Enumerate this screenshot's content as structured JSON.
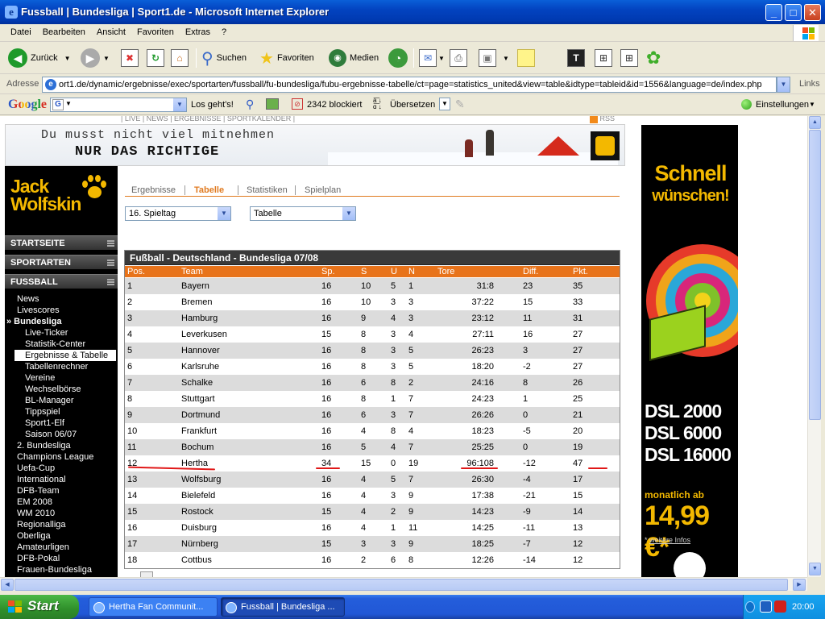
{
  "window": {
    "title": "Fussball | Bundesliga | Sport1.de - Microsoft Internet Explorer",
    "minimize": "_",
    "maximize": "□",
    "close": "✕"
  },
  "menu": [
    "Datei",
    "Bearbeiten",
    "Ansicht",
    "Favoriten",
    "Extras",
    "?"
  ],
  "toolbar": {
    "back": "Zurück",
    "search": "Suchen",
    "favorites": "Favoriten",
    "media": "Medien"
  },
  "address": {
    "label": "Adresse",
    "url": "ort1.de/dynamic/ergebnisse/exec/sportarten/fussball/fu-bundesliga/fubu-ergebnisse-tabelle/ct=page=statistics_united&view=table&idtype=tableid&id=1556&language=de/index.php",
    "links": "Links"
  },
  "googlebar": {
    "logo": "Google",
    "go": "Los geht's!",
    "blocked": "2342 blockiert",
    "translate": "Übersetzen",
    "settings": "Einstellungen"
  },
  "page": {
    "topnav": "|  LIVE  |  NEWS  |  ERGEBNISSE  |  SPORTKALENDER  |",
    "rss": "RSS",
    "banner": {
      "line1": "Du musst nicht viel mitnehmen",
      "line2": "NUR DAS RICHTIGE"
    },
    "logo": {
      "line1": "Jack",
      "line2": "Wolfskin"
    },
    "nav_heads": [
      "STARTSEITE",
      "SPORTARTEN",
      "FUSSBALL"
    ],
    "nav_items": [
      {
        "label": "News",
        "indent": 15,
        "style": ""
      },
      {
        "label": "Livescores",
        "indent": 15,
        "style": ""
      },
      {
        "label": "» Bundesliga",
        "indent": 2,
        "style": "bold"
      },
      {
        "label": "Live-Ticker",
        "indent": 25,
        "style": ""
      },
      {
        "label": "Statistik-Center",
        "indent": 25,
        "style": ""
      },
      {
        "label": "Ergebnisse & Tabelle",
        "indent": 25,
        "style": "sel"
      },
      {
        "label": "Tabellenrechner",
        "indent": 25,
        "style": ""
      },
      {
        "label": "Vereine",
        "indent": 25,
        "style": ""
      },
      {
        "label": "Wechselbörse",
        "indent": 25,
        "style": ""
      },
      {
        "label": "BL-Manager",
        "indent": 25,
        "style": ""
      },
      {
        "label": "Tippspiel",
        "indent": 25,
        "style": ""
      },
      {
        "label": "Sport1-Elf",
        "indent": 25,
        "style": ""
      },
      {
        "label": "Saison 06/07",
        "indent": 25,
        "style": ""
      },
      {
        "label": "2. Bundesliga",
        "indent": 15,
        "style": ""
      },
      {
        "label": "Champions League",
        "indent": 15,
        "style": ""
      },
      {
        "label": "Uefa-Cup",
        "indent": 15,
        "style": ""
      },
      {
        "label": "International",
        "indent": 15,
        "style": ""
      },
      {
        "label": "DFB-Team",
        "indent": 15,
        "style": ""
      },
      {
        "label": "EM 2008",
        "indent": 15,
        "style": ""
      },
      {
        "label": "WM 2010",
        "indent": 15,
        "style": ""
      },
      {
        "label": "Regionalliga",
        "indent": 15,
        "style": ""
      },
      {
        "label": "Oberliga",
        "indent": 15,
        "style": ""
      },
      {
        "label": "Amateurligen",
        "indent": 15,
        "style": ""
      },
      {
        "label": "DFB-Pokal",
        "indent": 15,
        "style": ""
      },
      {
        "label": "Frauen-Bundesliga",
        "indent": 15,
        "style": ""
      }
    ],
    "tabs": [
      "Ergebnisse",
      "Tabelle",
      "Statistiken",
      "Spielplan"
    ],
    "active_tab": "Tabelle",
    "matchday_select": "16. Spieltag",
    "view_select": "Tabelle",
    "table": {
      "title": "Fußball - Deutschland - Bundesliga 07/08",
      "headers": [
        "Pos.",
        "Team",
        "Sp.",
        "S",
        "U",
        "N",
        "Tore",
        "Diff.",
        "Pkt."
      ],
      "rows": [
        [
          "1",
          "Bayern",
          "16",
          "10",
          "5",
          "1",
          "31:8",
          "23",
          "35"
        ],
        [
          "2",
          "Bremen",
          "16",
          "10",
          "3",
          "3",
          "37:22",
          "15",
          "33"
        ],
        [
          "3",
          "Hamburg",
          "16",
          "9",
          "4",
          "3",
          "23:12",
          "11",
          "31"
        ],
        [
          "4",
          "Leverkusen",
          "15",
          "8",
          "3",
          "4",
          "27:11",
          "16",
          "27"
        ],
        [
          "5",
          "Hannover",
          "16",
          "8",
          "3",
          "5",
          "26:23",
          "3",
          "27"
        ],
        [
          "6",
          "Karlsruhe",
          "16",
          "8",
          "3",
          "5",
          "18:20",
          "-2",
          "27"
        ],
        [
          "7",
          "Schalke",
          "16",
          "6",
          "8",
          "2",
          "24:16",
          "8",
          "26"
        ],
        [
          "8",
          "Stuttgart",
          "16",
          "8",
          "1",
          "7",
          "24:23",
          "1",
          "25"
        ],
        [
          "9",
          "Dortmund",
          "16",
          "6",
          "3",
          "7",
          "26:26",
          "0",
          "21"
        ],
        [
          "10",
          "Frankfurt",
          "16",
          "4",
          "8",
          "4",
          "18:23",
          "-5",
          "20"
        ],
        [
          "11",
          "Bochum",
          "16",
          "5",
          "4",
          "7",
          "25:25",
          "0",
          "19"
        ],
        [
          "12",
          "Hertha",
          "34",
          "15",
          "0",
          "19",
          "96:108",
          "-12",
          "47"
        ],
        [
          "13",
          "Wolfsburg",
          "16",
          "4",
          "5",
          "7",
          "26:30",
          "-4",
          "17"
        ],
        [
          "14",
          "Bielefeld",
          "16",
          "4",
          "3",
          "9",
          "17:38",
          "-21",
          "15"
        ],
        [
          "15",
          "Rostock",
          "15",
          "4",
          "2",
          "9",
          "14:23",
          "-9",
          "14"
        ],
        [
          "16",
          "Duisburg",
          "16",
          "4",
          "1",
          "11",
          "14:25",
          "-11",
          "13"
        ],
        [
          "17",
          "Nürnberg",
          "15",
          "3",
          "3",
          "9",
          "18:25",
          "-7",
          "12"
        ],
        [
          "18",
          "Cottbus",
          "16",
          "2",
          "6",
          "8",
          "12:26",
          "-14",
          "12"
        ]
      ]
    },
    "ad": {
      "headline1": "Schnell",
      "headline2": "wünschen!",
      "dsl": [
        "DSL 2000",
        "DSL 6000",
        "DSL 16000"
      ],
      "monthly": "monatlich ab",
      "price": "14,99 €*",
      "info_prefix": "* ",
      "info": "weitere Infos"
    }
  },
  "taskbar": {
    "start": "Start",
    "tasks": [
      "Hertha Fan Communit...",
      "Fussball | Bundesliga ..."
    ],
    "clock": "20:00"
  },
  "colors": {
    "accent_orange": "#e8731a",
    "brand_yellow": "#f3b800",
    "highlight_red": "#e01818"
  }
}
